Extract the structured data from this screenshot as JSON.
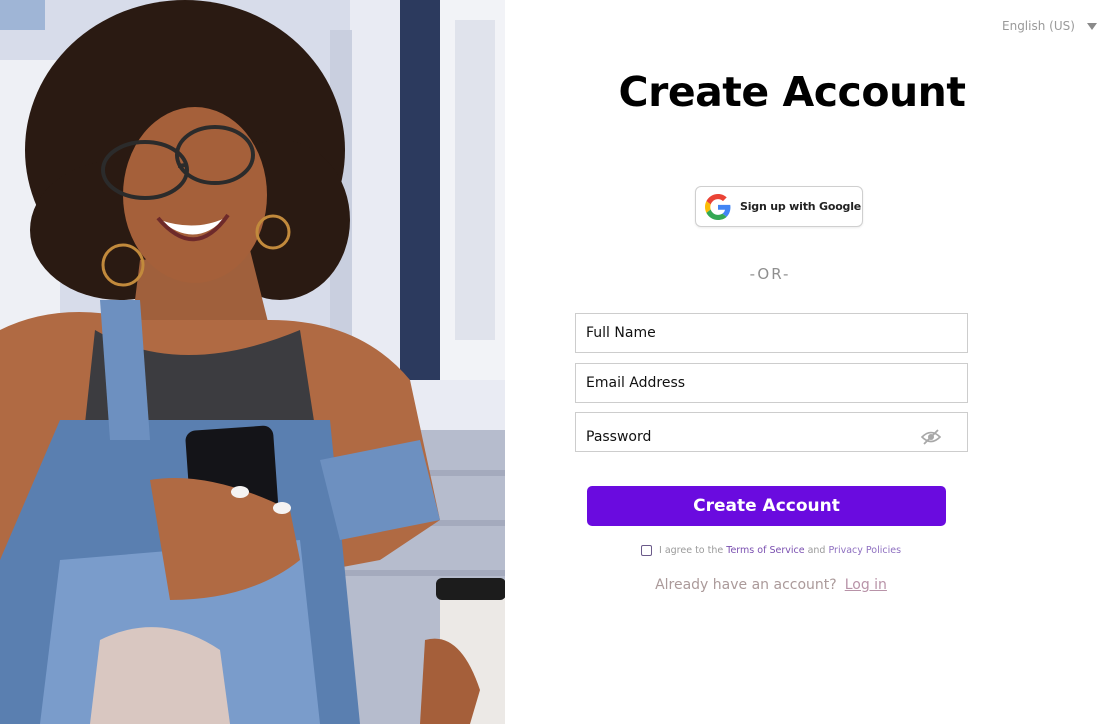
{
  "language": {
    "selected": "English (US)"
  },
  "form": {
    "title": "Create Account",
    "google_label": "Sign up with Google",
    "or_separator": "-OR-",
    "fields": {
      "full_name_placeholder": "Full Name",
      "email_placeholder": "Email Address",
      "password_placeholder": "Password"
    },
    "submit_label": "Create Account",
    "agree": {
      "prefix": "I agree to the",
      "terms": "Terms of Service",
      "conjunction": "and",
      "privacy": "Privacy Policies"
    },
    "login": {
      "prompt": "Already have an account?",
      "link": "Log in"
    }
  },
  "icons": {
    "language_caret": "chevron-down-icon",
    "google": "google-logo-icon",
    "password_toggle": "eye-off-icon"
  },
  "colors": {
    "accent": "#6a0bdf",
    "link": "#7a4fb0",
    "muted_text": "#9a9a9a"
  }
}
